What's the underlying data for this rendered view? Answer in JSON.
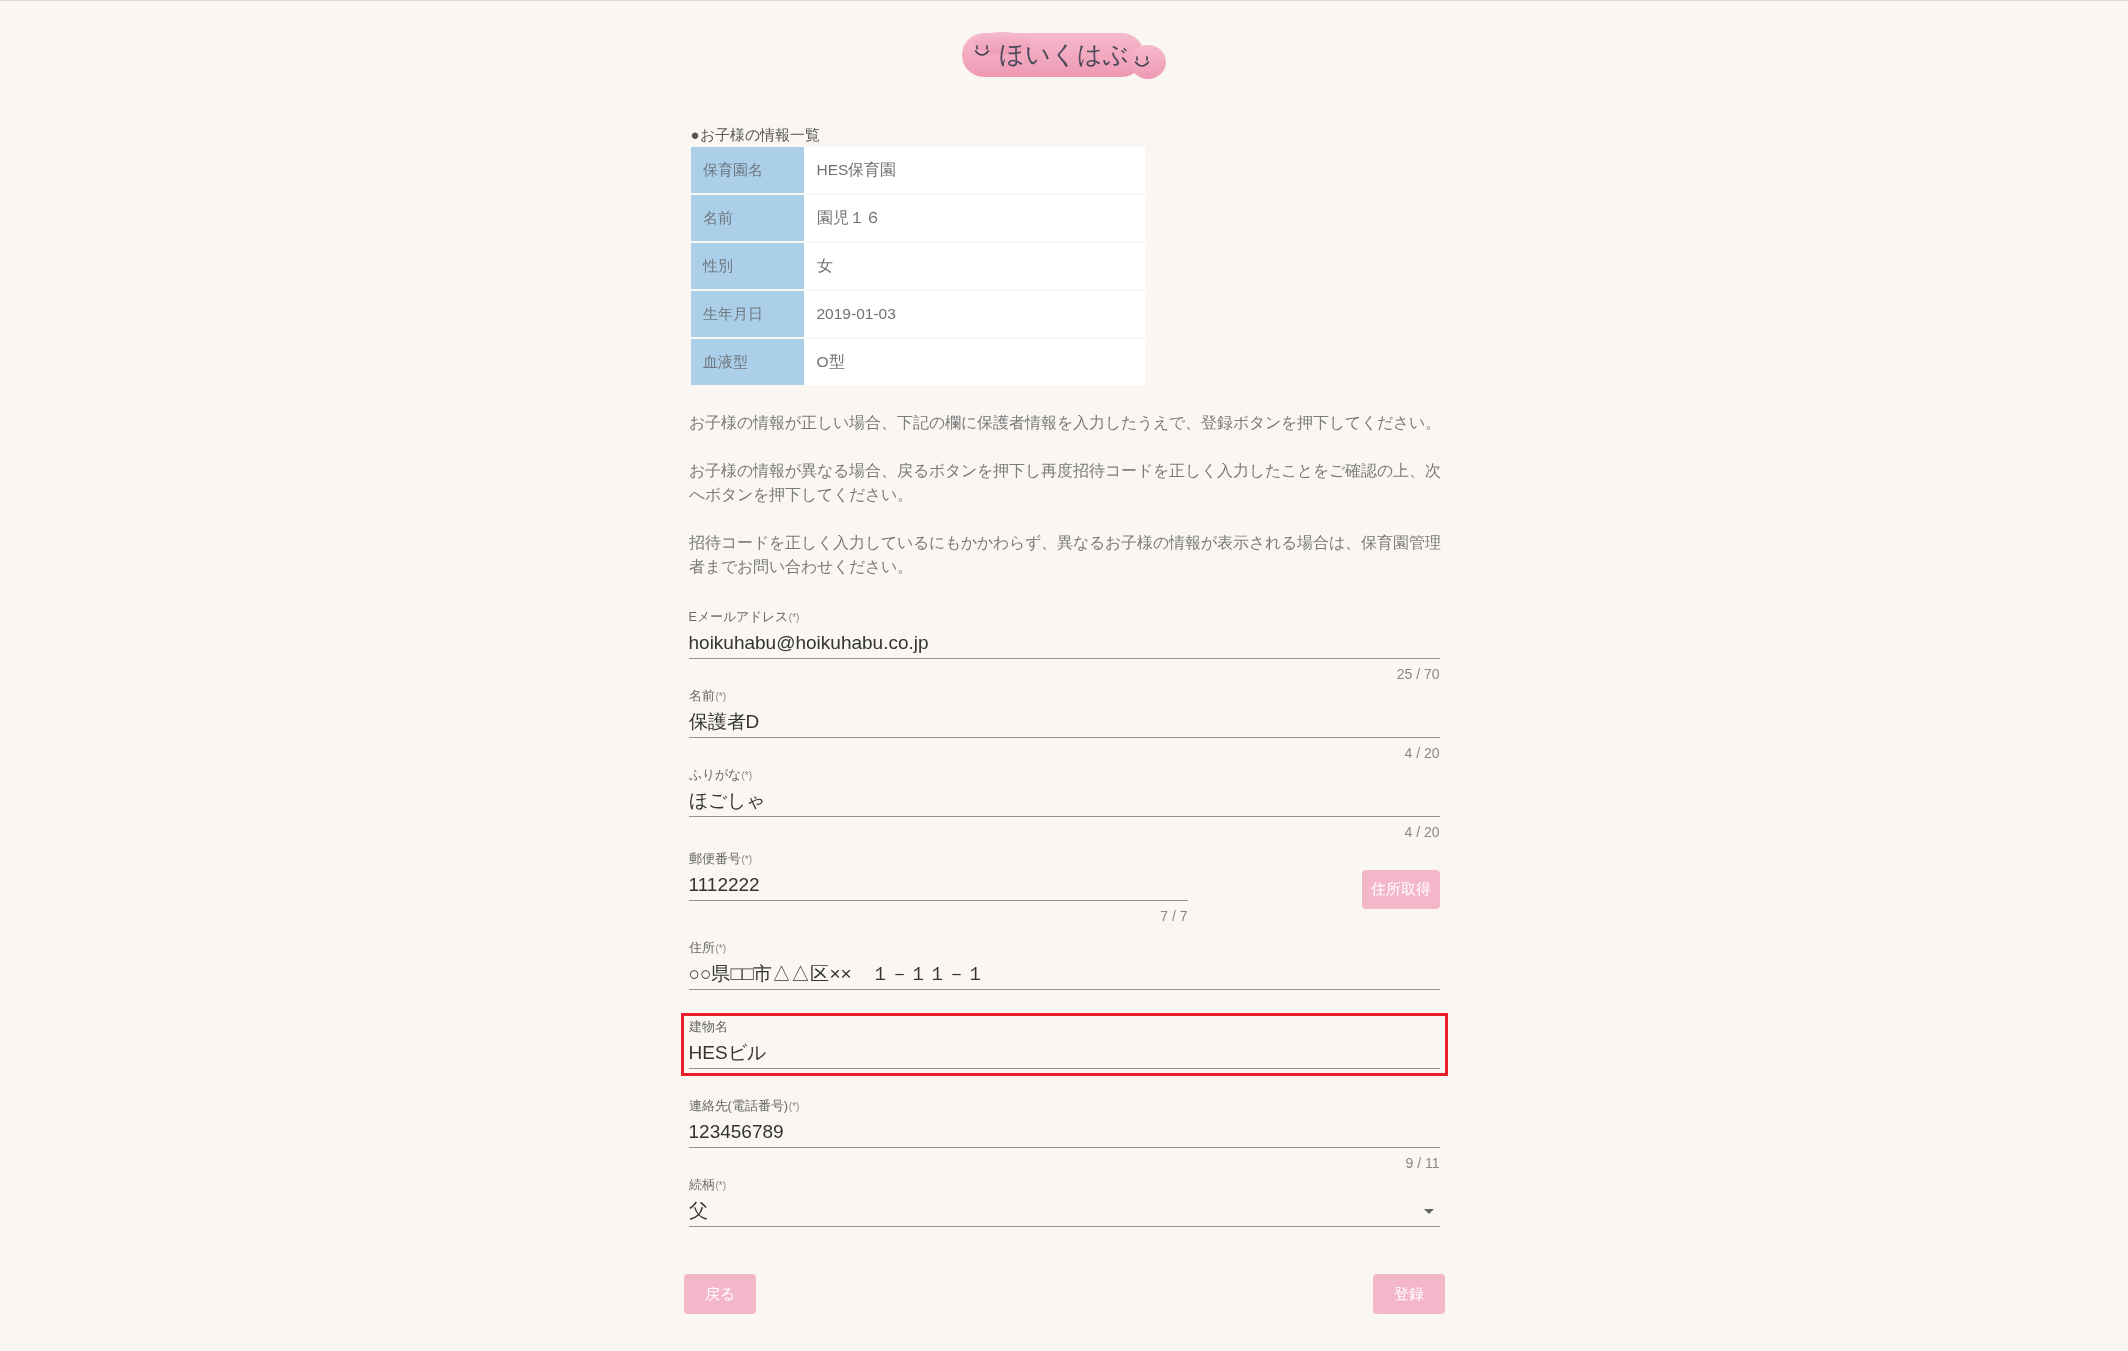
{
  "logo": {
    "text": "ほいくはぶ"
  },
  "child_info": {
    "title": "●お子様の情報一覧",
    "rows": [
      {
        "label": "保育園名",
        "value": "HES保育園"
      },
      {
        "label": "名前",
        "value": "園児１６"
      },
      {
        "label": "性別",
        "value": "女"
      },
      {
        "label": "生年月日",
        "value": "2019-01-03"
      },
      {
        "label": "血液型",
        "value": "O型"
      }
    ]
  },
  "notes": [
    "お子様の情報が正しい場合、下記の欄に保護者情報を入力したうえで、登録ボタンを押下してください。",
    "お子様の情報が異なる場合、戻るボタンを押下し再度招待コードを正しく入力したことをご確認の上、次へボタンを押下してください。",
    "招待コードを正しく入力しているにもかかわらず、異なるお子様の情報が表示される場合は、保育園管理者までお問い合わせください。"
  ],
  "form": {
    "fields": [
      {
        "kind": "text",
        "label": "Eメールアドレス",
        "required_mark": "(*)",
        "value": "hoikuhabu@hoikuhabu.co.jp",
        "counter": "25 / 70",
        "highlighted": false
      },
      {
        "kind": "text",
        "label": "名前",
        "required_mark": "(*)",
        "value": "保護者D",
        "counter": "4 / 20",
        "highlighted": false
      },
      {
        "kind": "text",
        "label": "ふりがな",
        "required_mark": "(*)",
        "value": "ほごしゃ",
        "counter": "4 / 20",
        "highlighted": false
      },
      {
        "kind": "text_with_button",
        "label": "郵便番号",
        "required_mark": "(*)",
        "value": "1112222",
        "counter": "7 / 7",
        "button": "住所取得",
        "highlighted": false
      },
      {
        "kind": "text",
        "label": "住所",
        "required_mark": "(*)",
        "value": "○○県□□市△△区××　１－１１－１",
        "highlighted": false
      },
      {
        "kind": "text",
        "label": "建物名",
        "value": "HESビル",
        "highlighted": true
      },
      {
        "kind": "text",
        "label": "連絡先(電話番号)",
        "required_mark": "(*)",
        "value": "123456789",
        "counter": "9 / 11",
        "highlighted": false
      },
      {
        "kind": "select",
        "label": "続柄",
        "required_mark": "(*)",
        "value": "父",
        "highlighted": false
      }
    ]
  },
  "buttons": [
    {
      "kind": "back",
      "label": "戻る"
    },
    {
      "kind": "submit",
      "label": "登録"
    }
  ]
}
